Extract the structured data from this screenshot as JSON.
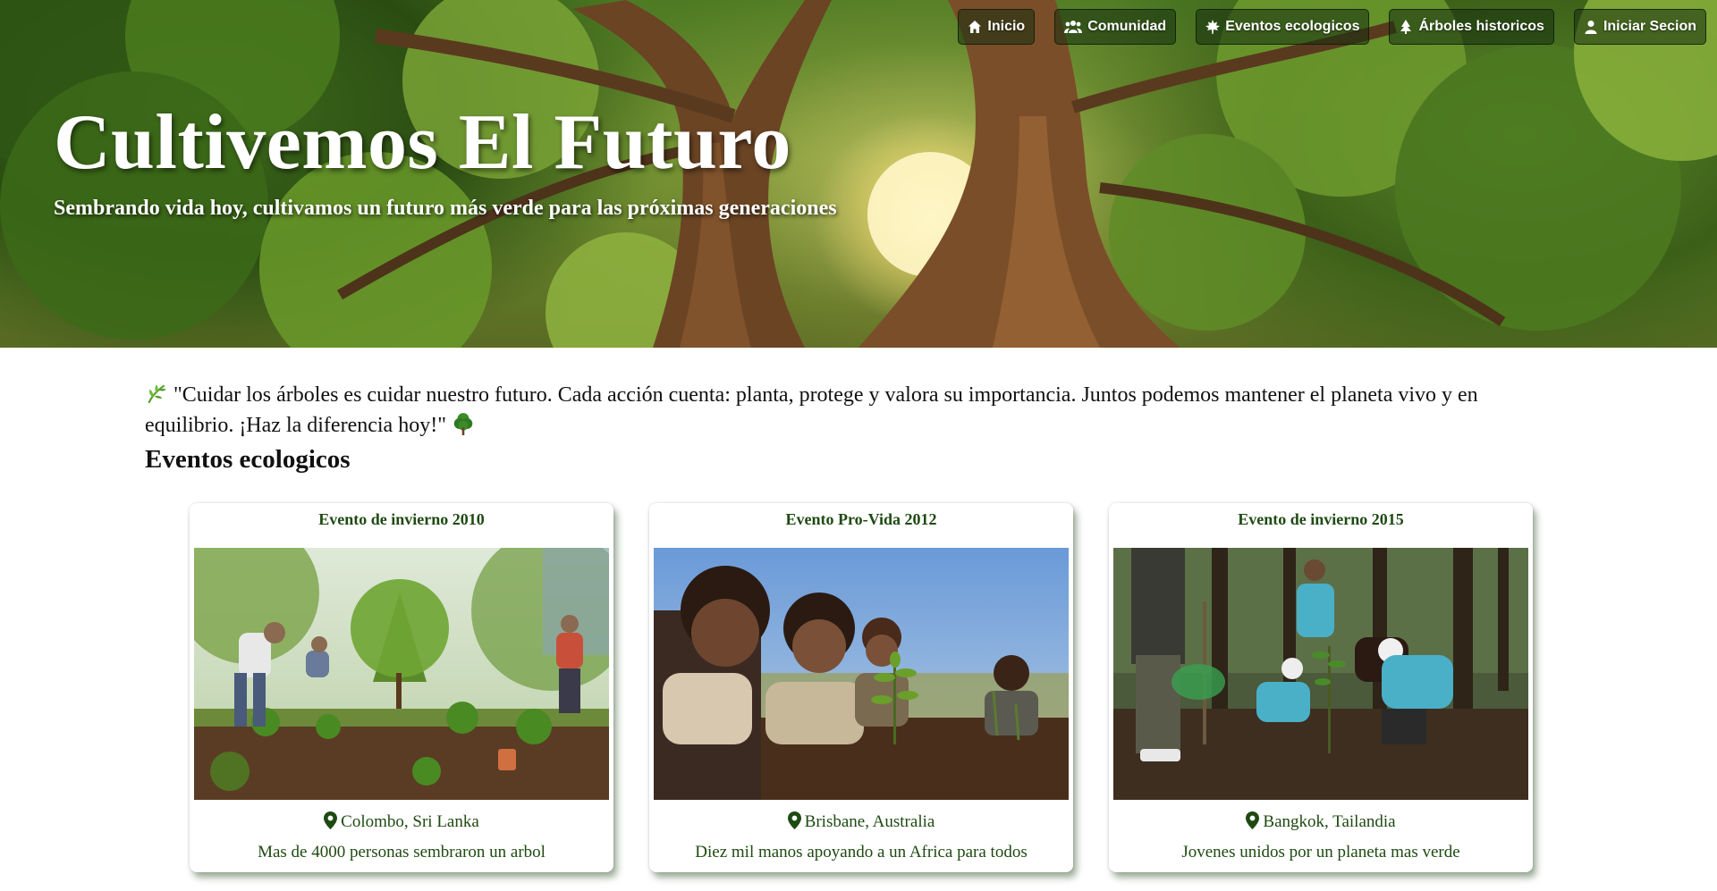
{
  "nav": {
    "items": [
      {
        "label": "Inicio",
        "icon": "home-icon"
      },
      {
        "label": "Comunidad",
        "icon": "users-icon"
      },
      {
        "label": "Eventos ecologicos",
        "icon": "leaf-icon"
      },
      {
        "label": "Árboles historicos",
        "icon": "tree-icon"
      },
      {
        "label": "Iniciar Secion",
        "icon": "user-icon"
      }
    ]
  },
  "hero": {
    "title": "Cultivemos El Futuro",
    "subtitle": "Sembrando vida hoy, cultivamos un futuro más verde para las próximas generaciones"
  },
  "quote": {
    "text": "\"Cuidar los árboles es cuidar nuestro futuro. Cada acción cuenta: planta, protege y valora su importancia. Juntos podemos mantener el planeta vivo y en equilibrio. ¡Haz la diferencia hoy!\"",
    "lead_icon": "herb-icon",
    "trail_icon": "tree-icon"
  },
  "events": {
    "title": "Eventos ecologicos",
    "cards": [
      {
        "title": "Evento de invierno 2010",
        "location": "Colombo, Sri Lanka",
        "description": "Mas de 4000 personas sembraron un arbol"
      },
      {
        "title": "Evento Pro-Vida 2012",
        "location": "Brisbane, Australia",
        "description": "Diez mil manos apoyando a un Africa para todos"
      },
      {
        "title": "Evento de invierno 2015",
        "location": "Bangkok, Tailandia",
        "description": "Jovenes unidos por un planeta mas verde"
      }
    ]
  },
  "colors": {
    "accent_green": "#1e4a12",
    "nav_bg": "#142d0f"
  }
}
